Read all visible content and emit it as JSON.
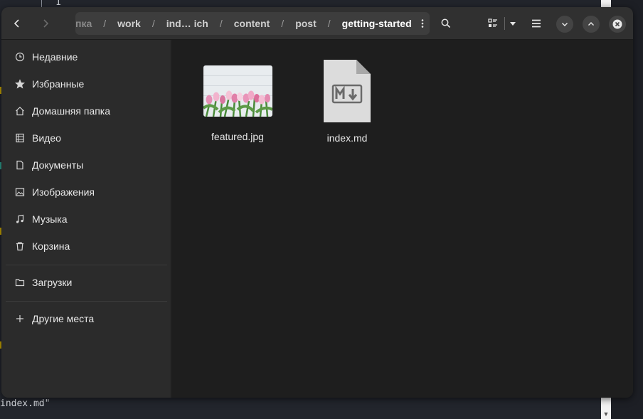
{
  "background": {
    "line_number": "1",
    "bottom_text": "index.md\""
  },
  "headerbar": {
    "back_icon": "chevron-left-icon",
    "forward_icon": "chevron-right-icon",
    "path": [
      {
        "label": "пка",
        "state": "cut"
      },
      {
        "label": "work",
        "state": "normal"
      },
      {
        "label": "ind… ich",
        "state": "normal"
      },
      {
        "label": "content",
        "state": "normal"
      },
      {
        "label": "post",
        "state": "normal"
      },
      {
        "label": "getting-started",
        "state": "current"
      }
    ],
    "separator": "/",
    "search_icon": "search-icon",
    "view_icon": "list-view-icon",
    "menu_icon": "hamburger-menu-icon",
    "minimize_icon": "chevron-down-icon",
    "maximize_icon": "chevron-up-icon",
    "close_icon": "close-icon"
  },
  "sidebar": {
    "items": [
      {
        "label": "Недавние",
        "icon": "clock-icon"
      },
      {
        "label": "Избранные",
        "icon": "star-icon"
      },
      {
        "label": "Домашняя папка",
        "icon": "home-icon"
      },
      {
        "label": "Видео",
        "icon": "film-icon"
      },
      {
        "label": "Документы",
        "icon": "document-icon"
      },
      {
        "label": "Изображения",
        "icon": "image-icon"
      },
      {
        "label": "Музыка",
        "icon": "music-icon"
      },
      {
        "label": "Корзина",
        "icon": "trash-icon"
      }
    ],
    "bookmarks": [
      {
        "label": "Загрузки",
        "icon": "folder-icon"
      }
    ],
    "other_places": {
      "label": "Другие места",
      "icon": "plus-icon"
    }
  },
  "files": [
    {
      "name": "featured.jpg",
      "kind": "image"
    },
    {
      "name": "index.md",
      "kind": "markdown"
    }
  ],
  "colors": {
    "headerbar": "#303030",
    "sidebar": "#2b2b2b",
    "content": "#1e1e1e",
    "pathbar": "#3d3d3d",
    "text": "#e8e8e8"
  }
}
